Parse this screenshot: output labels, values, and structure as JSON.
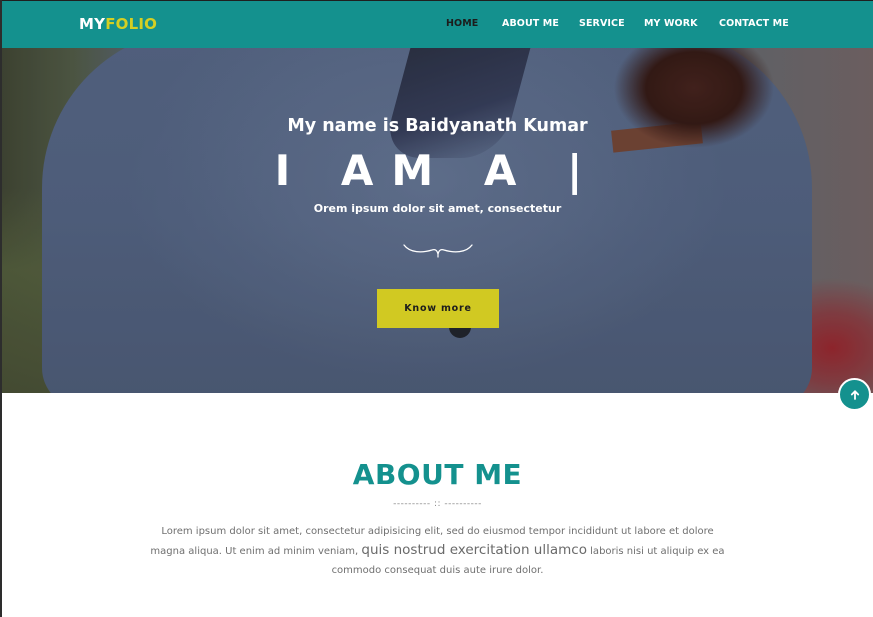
{
  "brand": {
    "part1": "MY",
    "part2": "FOLIO"
  },
  "nav": {
    "items": [
      {
        "label": "HOME",
        "active": true
      },
      {
        "label": "ABOUT ME",
        "active": false
      },
      {
        "label": "SERVICE",
        "active": false
      },
      {
        "label": "MY WORK",
        "active": false
      },
      {
        "label": "CONTACT ME",
        "active": false
      }
    ]
  },
  "hero": {
    "name_line": "My name is Baidyanath Kumar",
    "headline": "I AM A |",
    "subline": "Orem ipsum dolor sit amet, consectetur",
    "button_label": "Know more"
  },
  "scroll_top": {
    "icon": "arrow-up-icon"
  },
  "about": {
    "title": "ABOUT ME",
    "divider": "---------- :: ----------",
    "text_part1": "Lorem ipsum dolor sit amet, consectetur adipisicing elit, sed do eiusmod tempor incididunt ut labore et dolore magna aliqua. Ut enim ad minim veniam,",
    "text_emphasis": "quis nostrud exercitation ullamco",
    "text_part2": "laboris nisi ut aliquip ex ea commodo consequat duis aute irure dolor."
  },
  "colors": {
    "accent": "#14918e",
    "brand_yellow": "#d4cf23",
    "button_yellow": "#d1c922",
    "nav_active": "#1c1c1c"
  }
}
